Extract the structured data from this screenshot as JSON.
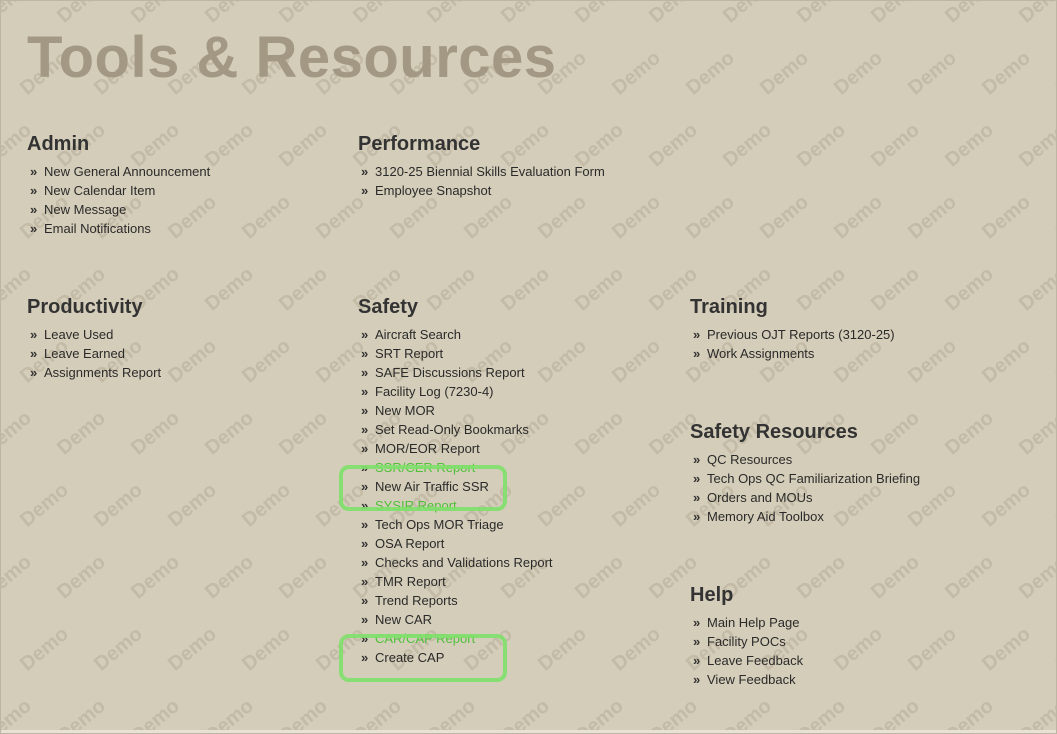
{
  "page": {
    "title": "Tools & Resources",
    "watermark": "Demo"
  },
  "colors": {
    "background": "#d4cdb9",
    "title": "#a39883",
    "link_green": "#4fbf3a",
    "highlight": "#7ee06a"
  },
  "icons": {
    "bullet": "double-chevron-right-icon"
  },
  "sections": {
    "admin": {
      "heading": "Admin",
      "items": [
        "New General Announcement",
        "New Calendar Item",
        "New Message",
        "Email Notifications"
      ]
    },
    "performance": {
      "heading": "Performance",
      "items": [
        "3120-25 Biennial Skills Evaluation Form",
        "Employee Snapshot"
      ]
    },
    "productivity": {
      "heading": "Productivity",
      "items": [
        "Leave Used",
        "Leave Earned",
        "Assignments Report"
      ]
    },
    "safety": {
      "heading": "Safety",
      "items": [
        "Aircraft Search",
        "SRT Report",
        "SAFE Discussions Report",
        "Facility Log (7230-4)",
        "New MOR",
        "Set Read-Only Bookmarks",
        "MOR/EOR Report",
        "SSR/CER Report",
        "New Air Traffic SSR",
        "SYSIR Report",
        "Tech Ops MOR Triage",
        "OSA Report",
        "Checks and Validations Report",
        "TMR Report",
        "Trend Reports",
        "New CAR",
        "CAR/CAP Report",
        "Create CAP"
      ]
    },
    "training": {
      "heading": "Training",
      "items": [
        "Previous OJT Reports (3120-25)",
        "Work Assignments"
      ]
    },
    "safety_resources": {
      "heading": "Safety Resources",
      "items": [
        "QC Resources",
        "Tech Ops QC Familiarization Briefing",
        "Orders and MOUs",
        "Memory Aid Toolbox"
      ]
    },
    "help": {
      "heading": "Help",
      "items": [
        "Main Help Page",
        "Facility POCs",
        "Leave Feedback",
        "View Feedback"
      ]
    }
  }
}
